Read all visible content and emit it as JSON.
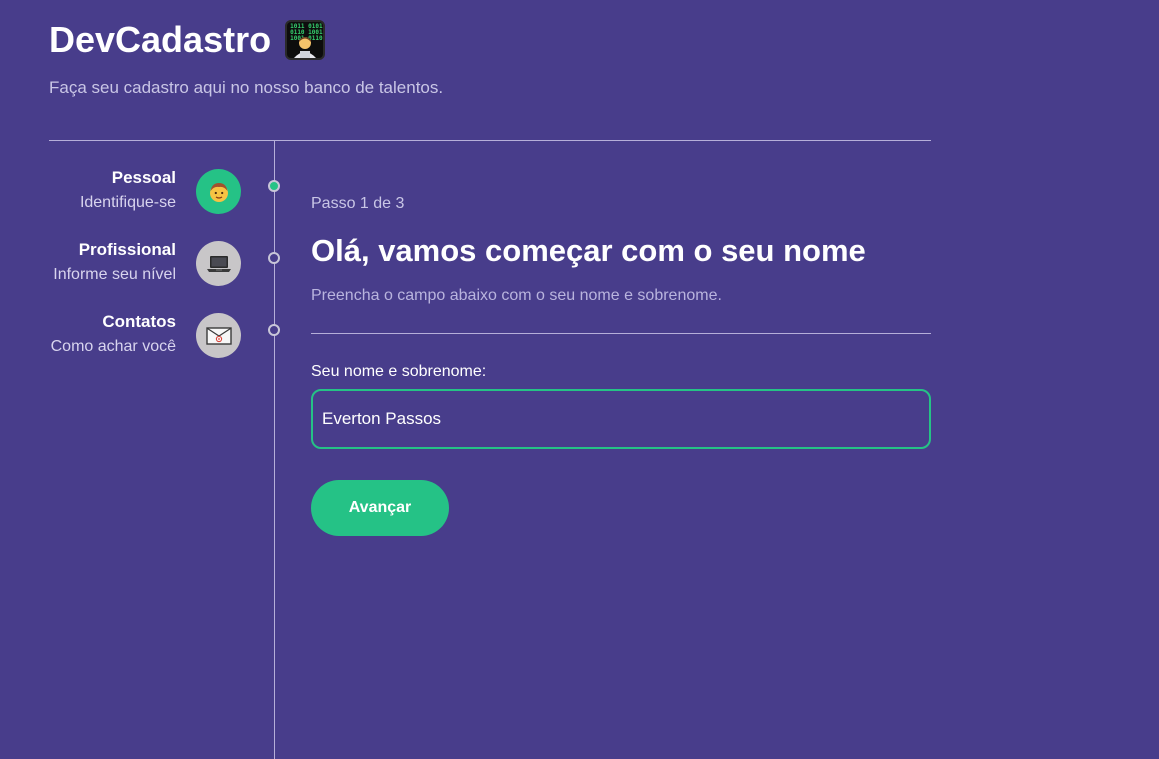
{
  "header": {
    "title": "DevCadastro",
    "title_icon": "technologist-icon",
    "subtitle": "Faça seu cadastro aqui no nosso banco de talentos."
  },
  "steps": [
    {
      "title": "Pessoal",
      "description": "Identifique-se",
      "icon": "boy-face-icon",
      "active": true
    },
    {
      "title": "Profissional",
      "description": "Informe seu nível",
      "icon": "laptop-icon",
      "active": false
    },
    {
      "title": "Contatos",
      "description": "Como achar você",
      "icon": "email-icon",
      "active": false
    }
  ],
  "content": {
    "step_counter": "Passo 1 de 3",
    "title": "Olá, vamos começar com o seu nome",
    "description": "Preencha o campo abaixo com o seu nome e sobrenome.",
    "field_label": "Seu nome e sobrenome:",
    "field_value": "Everton Passos",
    "next_label": "Avançar"
  },
  "colors": {
    "background": "#483d8b",
    "accent": "#25c286",
    "inactive_icon_bg": "#c8c6c8"
  }
}
